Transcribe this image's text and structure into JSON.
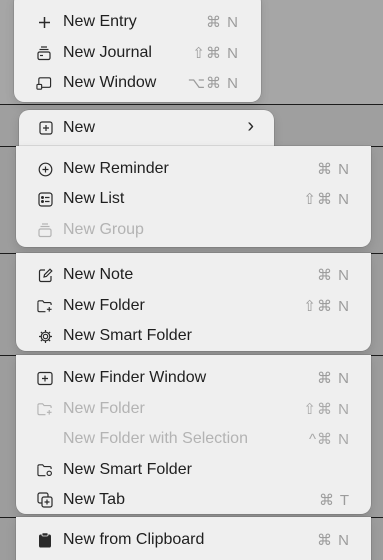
{
  "menu1": {
    "items": [
      {
        "label": "New Entry",
        "shortcut": "⌘ N",
        "icon": "plus-icon"
      },
      {
        "label": "New Journal",
        "shortcut": "⇧⌘ N",
        "icon": "journal-stack-icon"
      },
      {
        "label": "New Window",
        "shortcut": "⌥⌘ N",
        "icon": "window-icon"
      }
    ]
  },
  "menu2": {
    "items": [
      {
        "label": "New",
        "icon": "plus-square-icon",
        "submenu": "›"
      }
    ]
  },
  "menu3": {
    "items": [
      {
        "label": "New Reminder",
        "shortcut": "⌘ N",
        "icon": "plus-circle-icon"
      },
      {
        "label": "New List",
        "shortcut": "⇧⌘ N",
        "icon": "list-icon"
      },
      {
        "label": "New Group",
        "shortcut": "",
        "icon": "group-stack-icon",
        "disabled": true
      }
    ]
  },
  "menu4": {
    "items": [
      {
        "label": "New Note",
        "shortcut": "⌘ N",
        "icon": "compose-icon"
      },
      {
        "label": "New Folder",
        "shortcut": "⇧⌘ N",
        "icon": "folder-plus-icon"
      },
      {
        "label": "New Smart Folder",
        "shortcut": "",
        "icon": "gear-icon"
      }
    ]
  },
  "menu5": {
    "items": [
      {
        "label": "New Finder Window",
        "shortcut": "⌘ N",
        "icon": "finder-window-icon"
      },
      {
        "label": "New Folder",
        "shortcut": "⇧⌘ N",
        "icon": "folder-plus-icon",
        "disabled": true
      },
      {
        "label": "New Folder with Selection",
        "shortcut": "^⌘ N",
        "disabled": true
      },
      {
        "label": "New Smart Folder",
        "shortcut": "",
        "icon": "smart-folder-icon"
      },
      {
        "label": "New Tab",
        "shortcut": "⌘ T",
        "icon": "new-tab-icon"
      }
    ]
  },
  "menu6": {
    "items": [
      {
        "label": "New from Clipboard",
        "shortcut": "⌘ N",
        "icon": "clipboard-icon"
      }
    ]
  }
}
